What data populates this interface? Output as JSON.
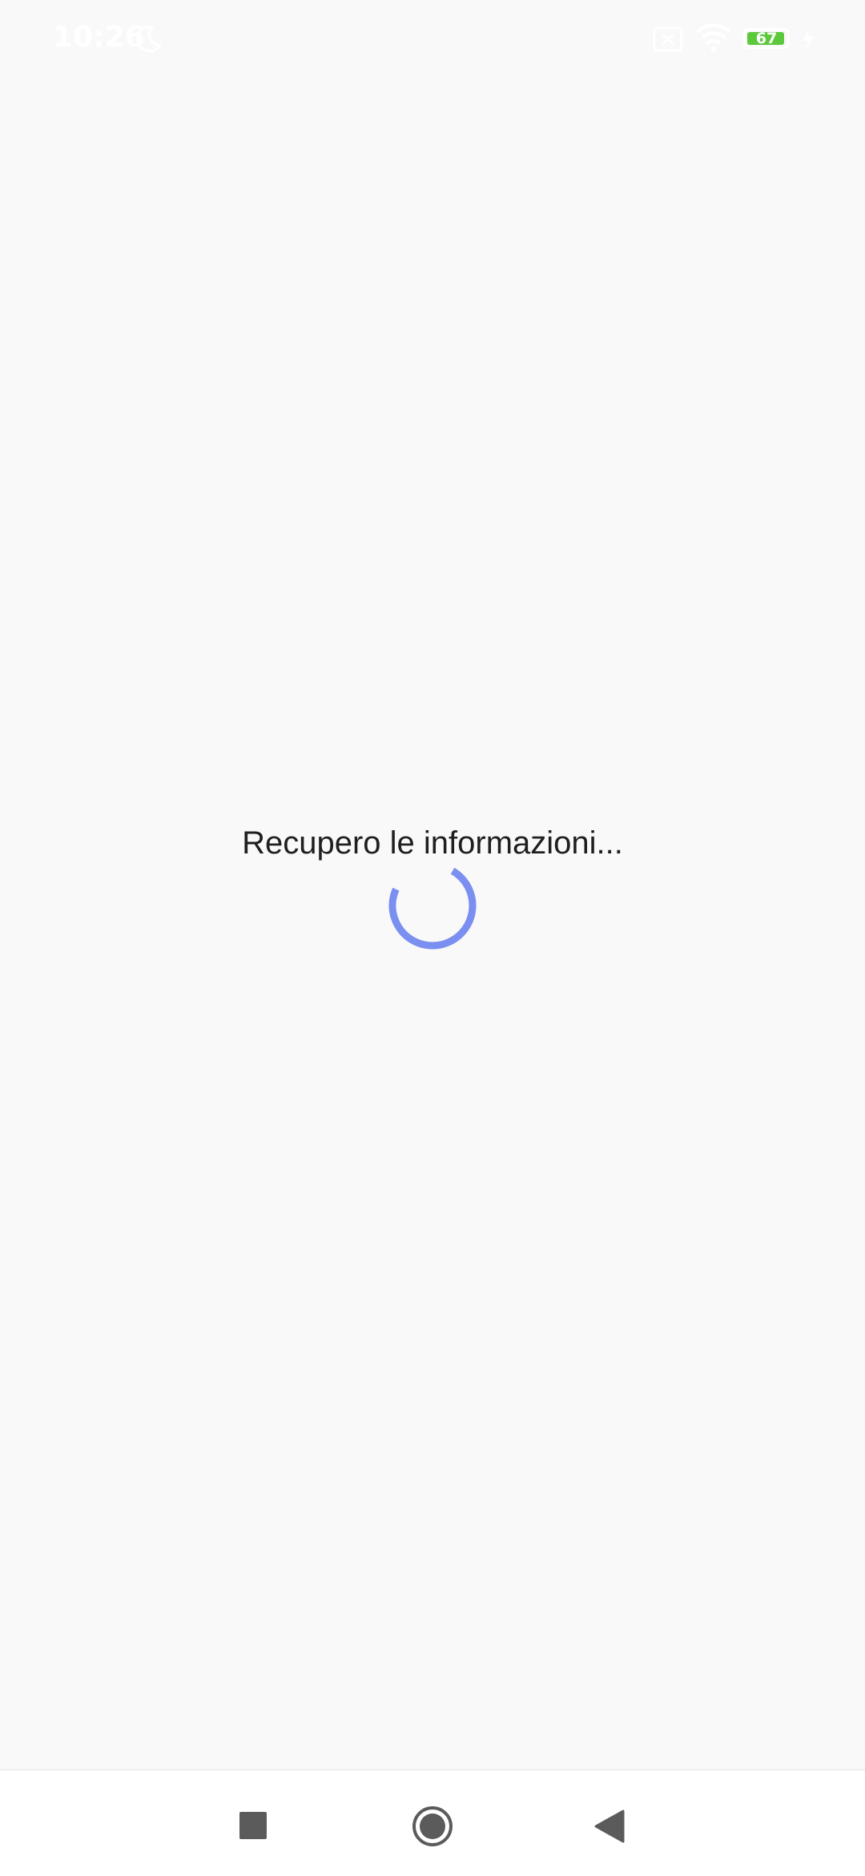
{
  "status_bar": {
    "time": "10:26",
    "battery_level": "67",
    "icons": [
      "moon-icon",
      "sim-icon",
      "wifi-icon",
      "battery-icon",
      "bolt-icon"
    ],
    "battery_color": "#5cc93d"
  },
  "main": {
    "loading_text": "Recupero le informazioni...",
    "spinner_color": "#7b8ff0"
  },
  "nav_bar": {
    "buttons": [
      "recent-apps",
      "home",
      "back"
    ],
    "icon_color": "#5b5b5b"
  }
}
